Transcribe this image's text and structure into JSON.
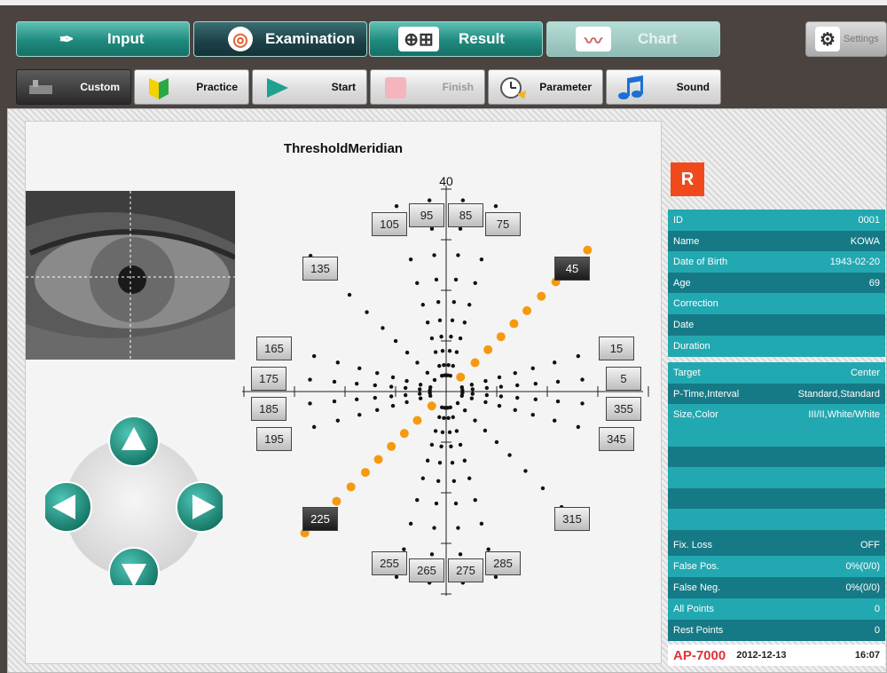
{
  "tabs": {
    "input": "Input",
    "examination": "Examination",
    "result": "Result",
    "chart": "Chart",
    "settings": "Settings"
  },
  "subtoolbar": {
    "custom": "Custom",
    "practice": "Practice",
    "start": "Start",
    "finish": "Finish",
    "parameter": "Parameter",
    "sound": "Sound"
  },
  "chart": {
    "title": "ThresholdMeridian",
    "scale_label": "40",
    "meridians": [
      "105",
      "95",
      "85",
      "75",
      "135",
      "45",
      "165",
      "15",
      "175",
      "5",
      "185",
      "355",
      "195",
      "345",
      "225",
      "315",
      "255",
      "265",
      "275",
      "285"
    ],
    "selected_meridians": [
      "45",
      "225"
    ]
  },
  "patient": {
    "eye": "R",
    "rows": [
      {
        "label": "ID",
        "value": "0001"
      },
      {
        "label": "Name",
        "value": "KOWA"
      },
      {
        "label": "Date of Birth",
        "value": "1943-02-20"
      },
      {
        "label": "Age",
        "value": "69"
      },
      {
        "label": "Correction",
        "value": ""
      },
      {
        "label": "Date",
        "value": ""
      },
      {
        "label": "Duration",
        "value": ""
      }
    ],
    "test_rows": [
      {
        "label": "Target",
        "value": "Center"
      },
      {
        "label": "P-Time,Interval",
        "value": "Standard,Standard"
      },
      {
        "label": "Size,Color",
        "value": "III/II,White/White"
      }
    ],
    "stats_rows": [
      {
        "label": "Fix. Loss",
        "value": "OFF"
      },
      {
        "label": "False Pos.",
        "value": "0%(0/0)"
      },
      {
        "label": "False Neg.",
        "value": "0%(0/0)"
      },
      {
        "label": "All Points",
        "value": "0"
      },
      {
        "label": "Rest Points",
        "value": "0"
      }
    ]
  },
  "footer": {
    "brand": "AP-7000",
    "date": "2012-12-13",
    "time": "16:07"
  },
  "colors": {
    "accent_teal": "#22a8b0",
    "dark_teal": "#167a86",
    "orange_points": "#f59a0f",
    "eye_badge": "#f04a1c"
  }
}
